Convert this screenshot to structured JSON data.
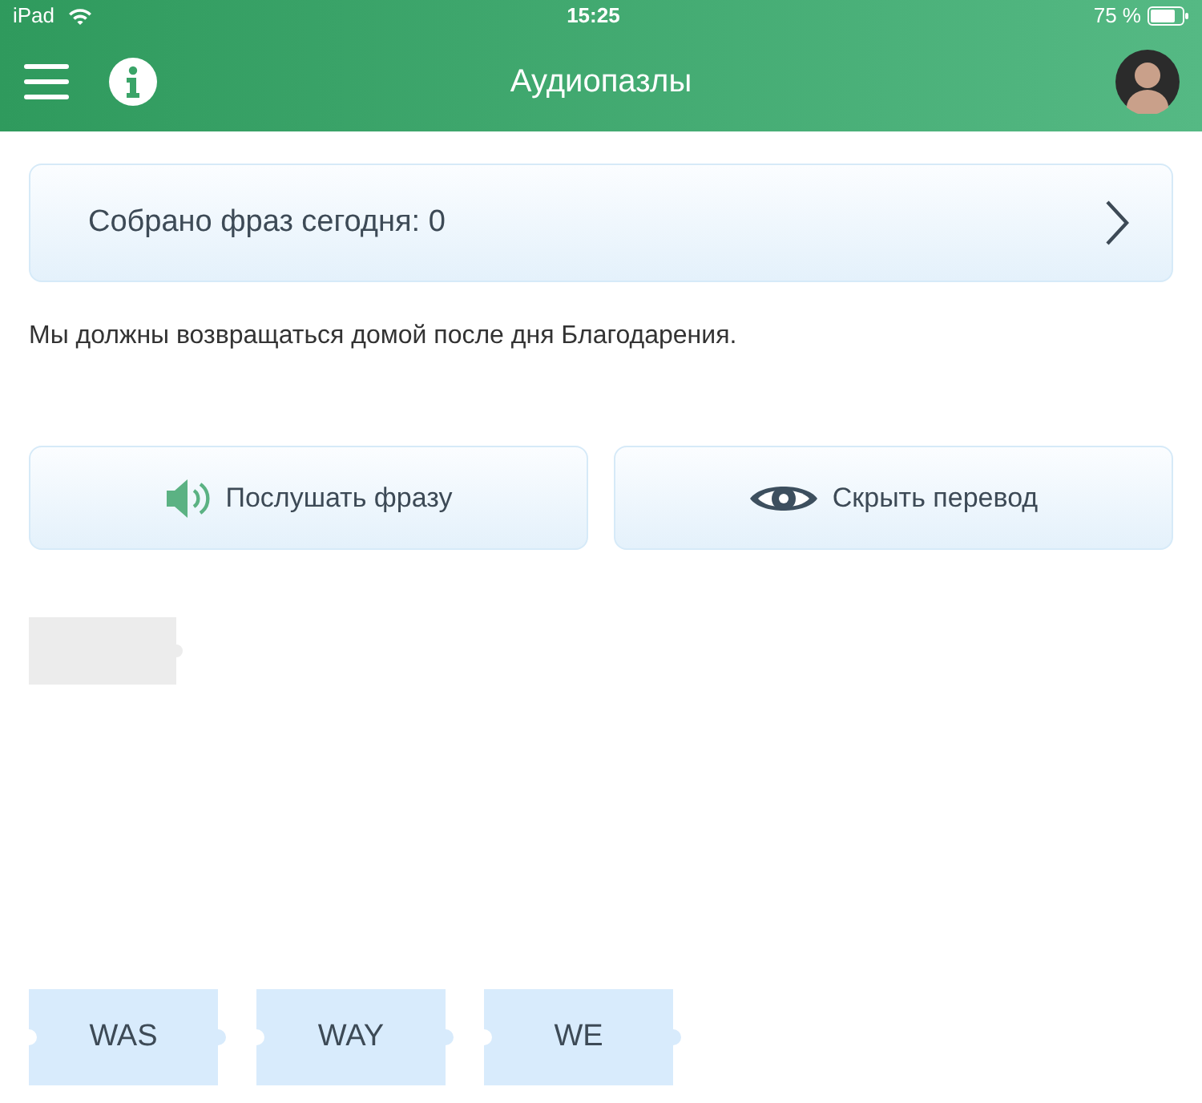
{
  "status_bar": {
    "device": "iPad",
    "time": "15:25",
    "battery": "75 %"
  },
  "header": {
    "title": "Аудиопазлы"
  },
  "progress_card": {
    "label": "Собрано фраз сегодня: 0"
  },
  "translation": "Мы должны возвращаться домой после дня Благодарения.",
  "buttons": [
    {
      "kind": "listen",
      "label": "Послушать фразу"
    },
    {
      "kind": "hide",
      "label": "Скрыть перевод"
    }
  ],
  "answer_slots": [
    {
      "kind": "empty"
    }
  ],
  "pieces": [
    {
      "word": "WAS"
    },
    {
      "word": "WAY"
    },
    {
      "word": "WE"
    }
  ]
}
